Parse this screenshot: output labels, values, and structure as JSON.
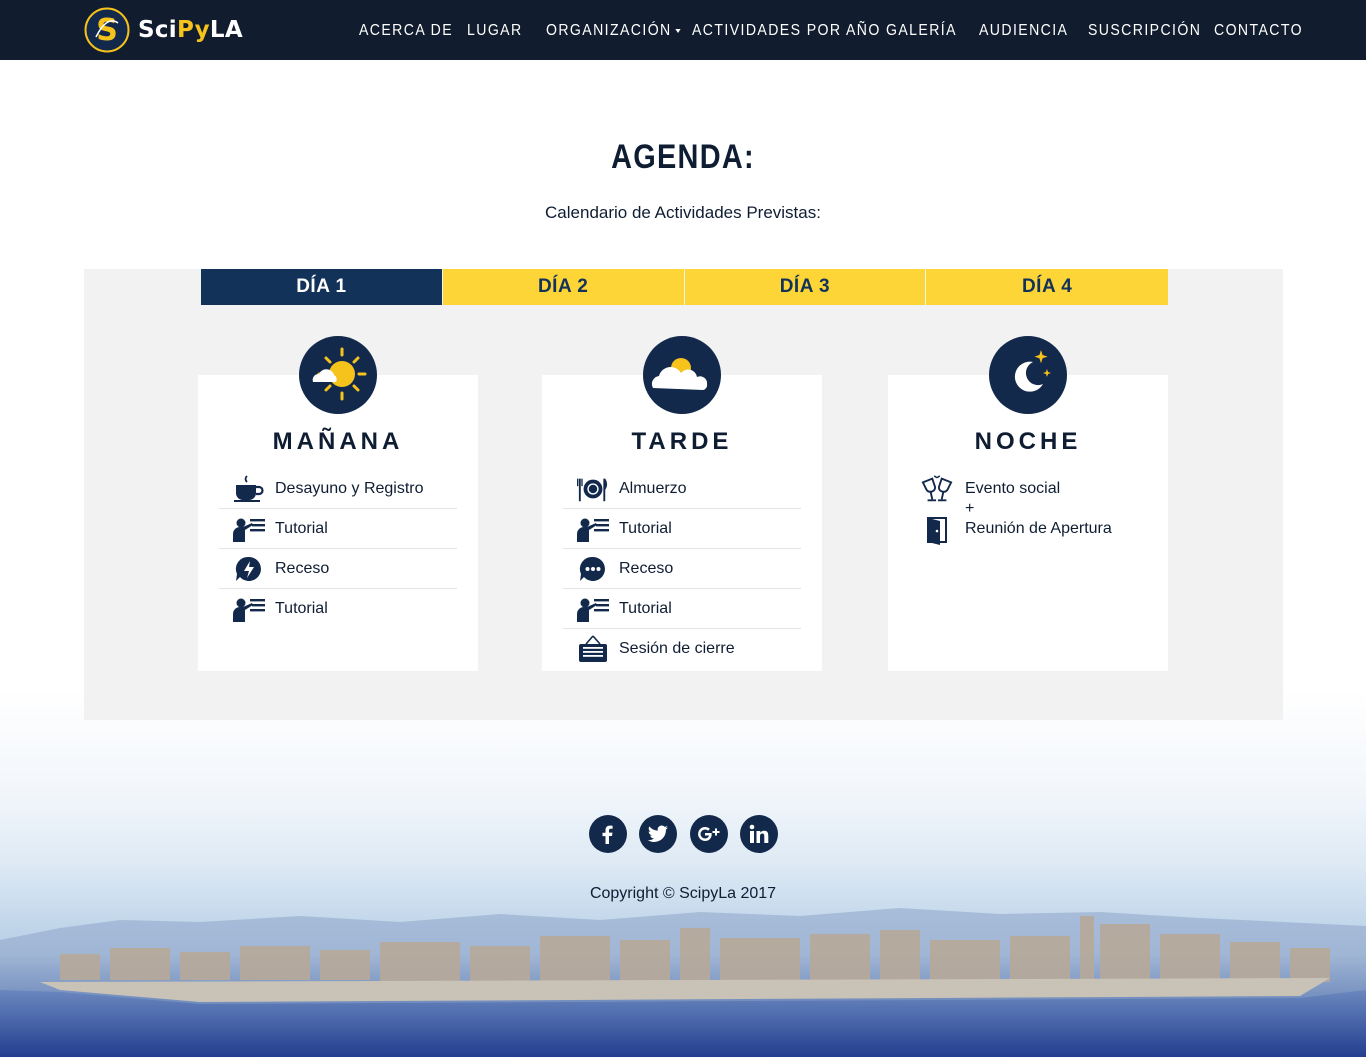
{
  "brand": {
    "name_prefix": "Sci",
    "name_highlight": "Py",
    "name_suffix": "LA",
    "logo_letter": "S"
  },
  "nav": {
    "items": [
      "ACERCA DE",
      "LUGAR",
      "ORGANIZACIÓN",
      "ACTIVIDADES POR AÑO",
      "GALERÍA",
      "AUDIENCIA",
      "SUSCRIPCIÓN",
      "CONTACTO"
    ]
  },
  "agenda": {
    "title": "AGENDA:",
    "subtitle": "Calendario de Actividades Previstas:",
    "tabs": [
      "DÍA 1",
      "DÍA 2",
      "DÍA 3",
      "DÍA 4"
    ],
    "active_tab": "DÍA 1",
    "sessions": {
      "morning": {
        "title": "MAÑANA",
        "icon": "sun-cloud-icon",
        "items": [
          {
            "label": "Desayuno y Registro",
            "icon": "coffee-cup-icon"
          },
          {
            "label": "Tutorial",
            "icon": "presenter-icon"
          },
          {
            "label": "Receso",
            "icon": "lightning-bubble-icon"
          },
          {
            "label": "Tutorial",
            "icon": "presenter-icon"
          }
        ]
      },
      "afternoon": {
        "title": "TARDE",
        "icon": "cloud-sun-icon",
        "items": [
          {
            "label": "Almuerzo",
            "icon": "plate-cutlery-icon"
          },
          {
            "label": "Tutorial",
            "icon": "presenter-icon"
          },
          {
            "label": "Receso",
            "icon": "chat-bubble-icon"
          },
          {
            "label": "Tutorial",
            "icon": "presenter-icon"
          },
          {
            "label": "Sesión de cierre",
            "icon": "close-sign-icon"
          }
        ]
      },
      "night": {
        "title": "NOCHE",
        "icon": "moon-stars-icon",
        "items": [
          {
            "label": "Evento social",
            "icon": "toast-glasses-icon"
          },
          {
            "label": "+",
            "icon": ""
          },
          {
            "label": "Reunión de Apertura",
            "icon": "open-door-icon"
          }
        ]
      }
    }
  },
  "footer": {
    "social": [
      "facebook-icon",
      "twitter-icon",
      "google-plus-icon",
      "linkedin-icon"
    ],
    "copyright": "Copyright © ScipyLa 2017"
  },
  "colors": {
    "navy": "#13294b",
    "yellow": "#fdd537",
    "accent_yellow": "#f6c21c"
  }
}
